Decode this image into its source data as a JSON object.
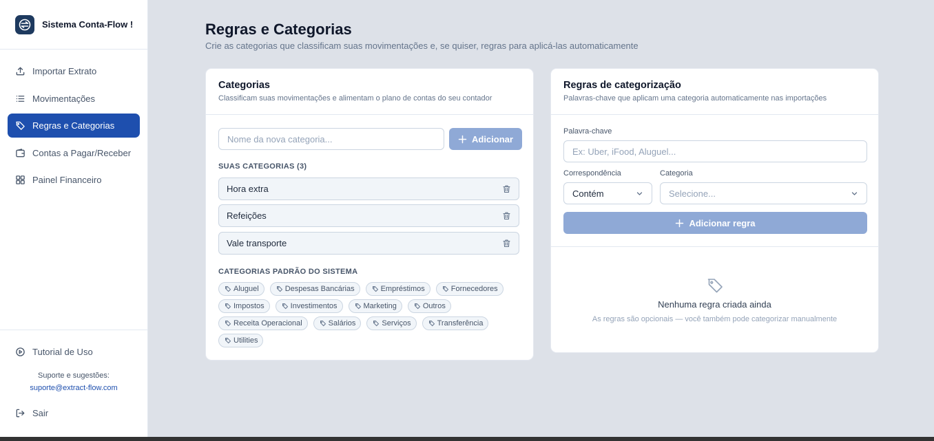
{
  "sidebar": {
    "brand": "Sistema Conta-Flow !",
    "items": [
      {
        "label": "Importar Extrato",
        "icon": "upload-icon"
      },
      {
        "label": "Movimentações",
        "icon": "list-icon"
      },
      {
        "label": "Regras e Categorias",
        "icon": "tag-icon",
        "active": true
      },
      {
        "label": "Contas a Pagar/Receber",
        "icon": "wallet-icon"
      },
      {
        "label": "Painel Financeiro",
        "icon": "dashboard-icon"
      }
    ],
    "tutorial": "Tutorial de Uso",
    "support_label": "Suporte e sugestões:",
    "support_email": "suporte@extract-flow.com",
    "logout": "Sair"
  },
  "header": {
    "title": "Regras e Categorias",
    "subtitle": "Crie as categorias que classificam suas movimentações e, se quiser, regras para aplicá-las automaticamente"
  },
  "categories_card": {
    "title": "Categorias",
    "description": "Classificam suas movimentações e alimentam o plano de contas do seu contador",
    "input_placeholder": "Nome da nova categoria...",
    "add_label": "Adicionar",
    "your_categories_label": "SUAS CATEGORIAS (3)",
    "user_categories": [
      "Hora extra",
      "Refeições",
      "Vale transporte"
    ],
    "default_label": "CATEGORIAS PADRÃO DO SISTEMA",
    "default_categories": [
      "Aluguel",
      "Despesas Bancárias",
      "Empréstimos",
      "Fornecedores",
      "Impostos",
      "Investimentos",
      "Marketing",
      "Outros",
      "Receita Operacional",
      "Salários",
      "Serviços",
      "Transferência",
      "Utilities"
    ]
  },
  "rules_card": {
    "title": "Regras de categorização",
    "description": "Palavras-chave que aplicam uma categoria automaticamente nas importações",
    "keyword_label": "Palavra-chave",
    "keyword_placeholder": "Ex: Uber, iFood, Aluguel...",
    "match_label": "Correspondência",
    "match_value": "Contém",
    "category_label": "Categoria",
    "category_placeholder": "Selecione...",
    "add_rule_label": "Adicionar regra",
    "empty_title": "Nenhuma regra criada ainda",
    "empty_desc": "As regras são opcionais — você também pode categorizar manualmente"
  },
  "colors": {
    "accent": "#1e4fae",
    "button_disabled": "#8fa9d6",
    "background": "#dde1e8"
  }
}
